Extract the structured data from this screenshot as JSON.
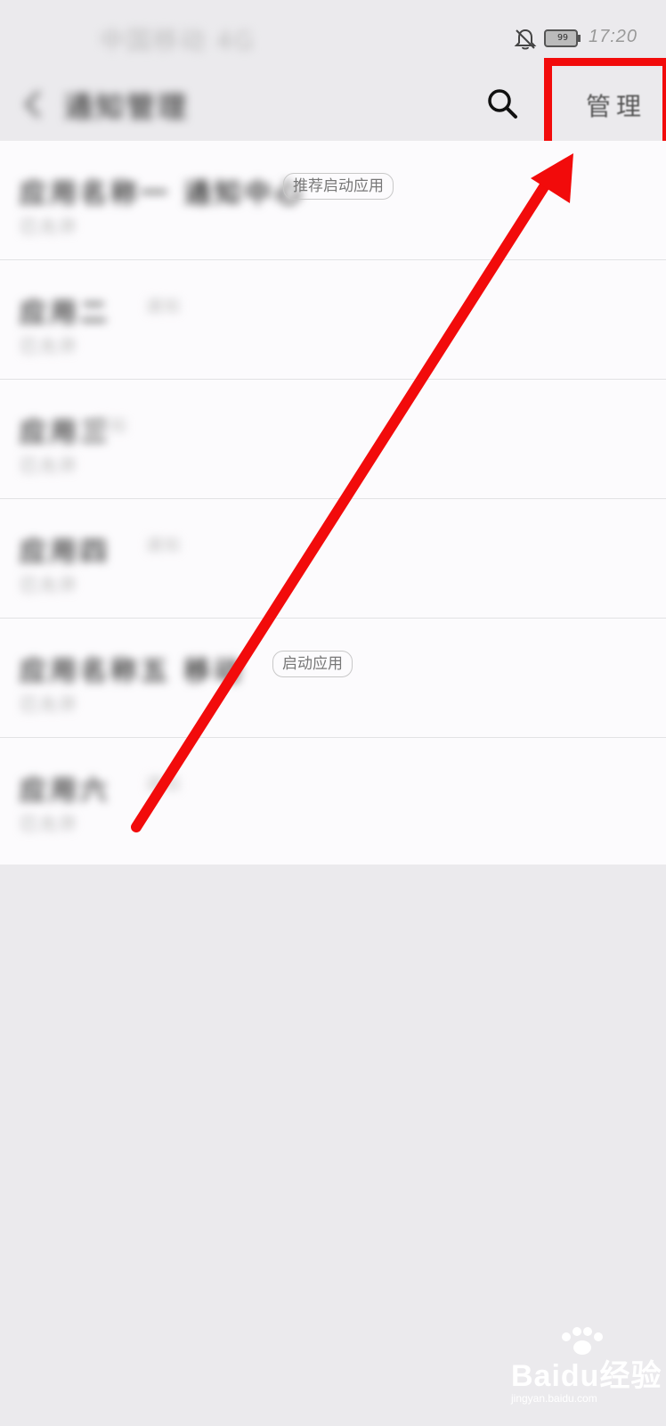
{
  "status_bar": {
    "carrier_text": "中国移动 4G",
    "battery_level": "99",
    "time": "17:20"
  },
  "header": {
    "title": "通知管理",
    "manage_label": "管理"
  },
  "apps": [
    {
      "title": "应用名称一 通知中心",
      "subtitle": "已允许",
      "tag": "推荐启动应用"
    },
    {
      "title": "应用二",
      "subtitle": "已允许",
      "tag_blur": "通知"
    },
    {
      "title": "应用三",
      "subtitle": "已允许",
      "tag_blur": "通知"
    },
    {
      "title": "应用四",
      "subtitle": "已允许",
      "tag_blur": "通知"
    },
    {
      "title": "应用名称五 移动",
      "subtitle": "已允许",
      "tag": "启动应用"
    },
    {
      "title": "应用六",
      "subtitle": "已允许",
      "tag_blur": "通知"
    }
  ],
  "watermark": {
    "text": "Baidu经验",
    "sub": "jingyan.baidu.com"
  },
  "colors": {
    "highlight": "#f20b0b",
    "background": "#ebeaed",
    "list_background": "#fcfbfd"
  },
  "icons": {
    "back": "back-icon",
    "search": "search-icon",
    "bell_off": "bell-off-icon",
    "battery": "battery-icon"
  }
}
